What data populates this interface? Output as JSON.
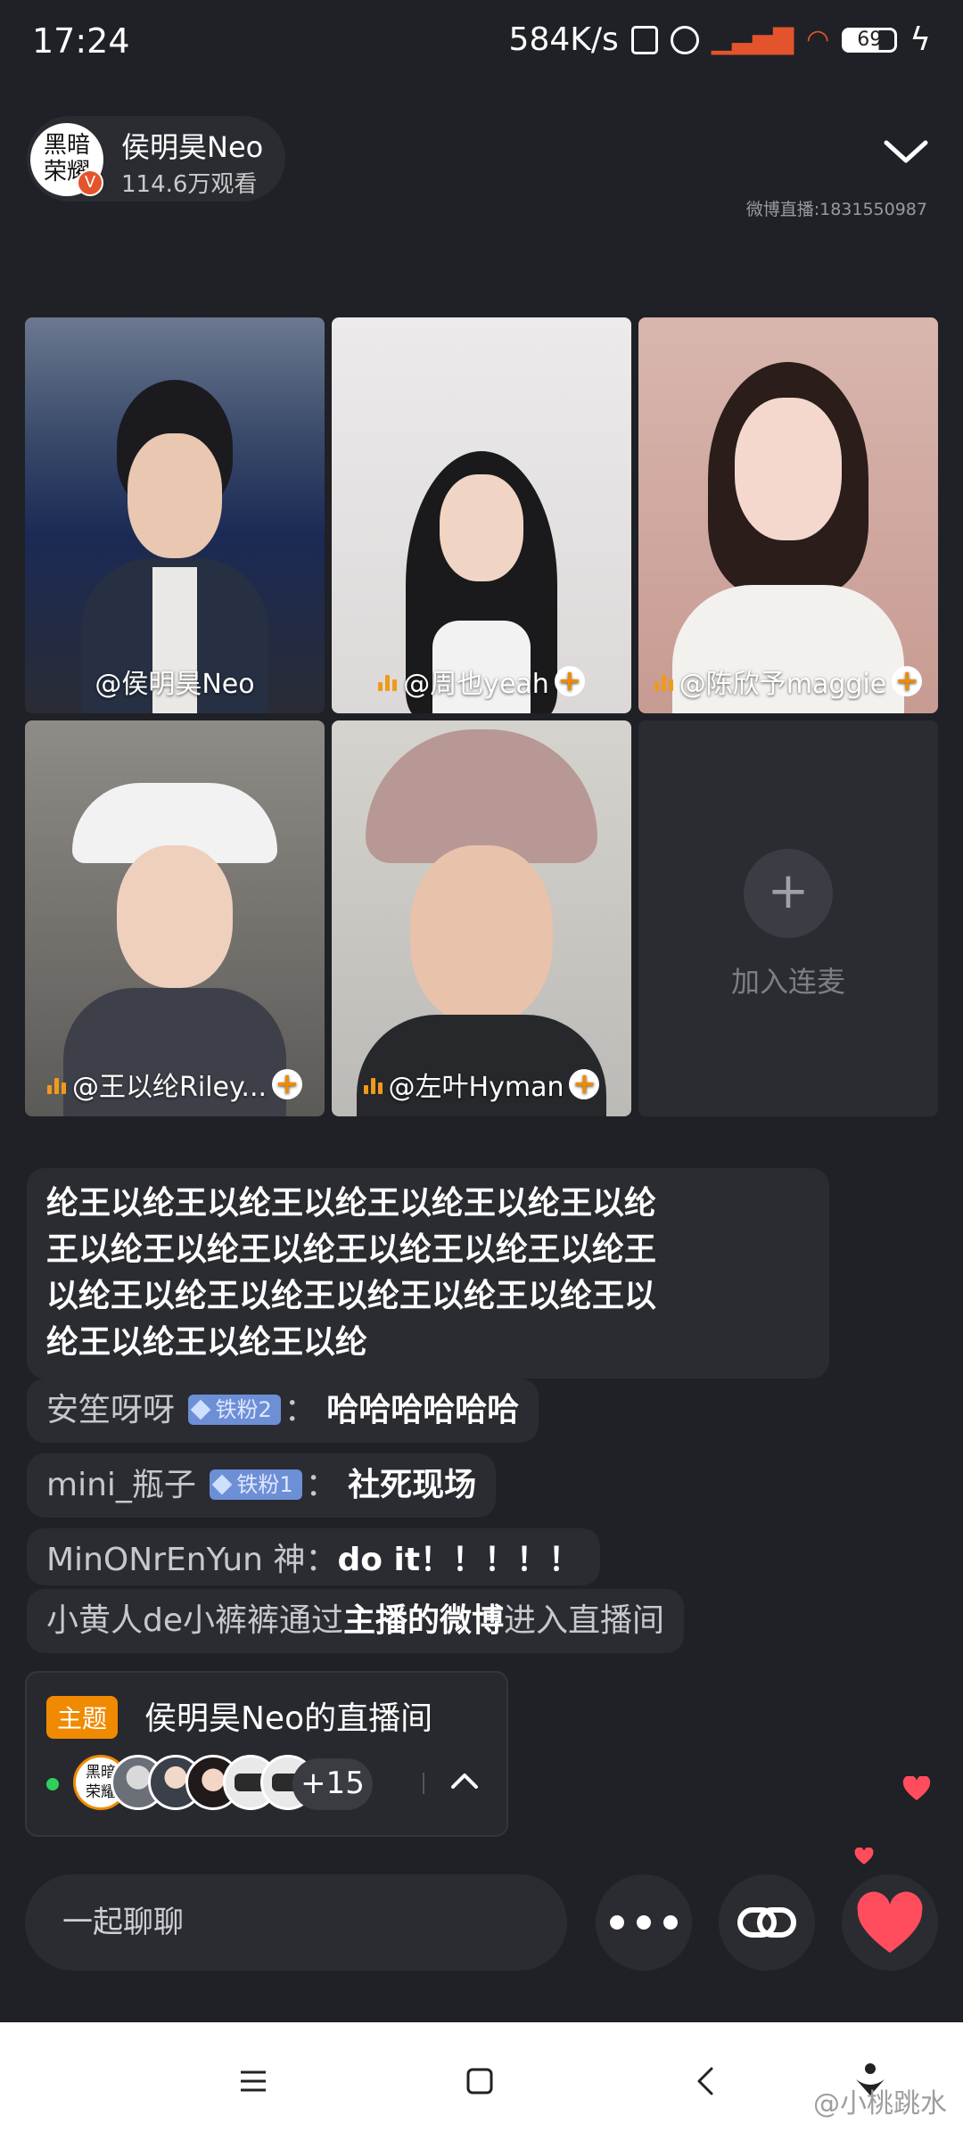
{
  "status": {
    "time": "17:24",
    "speed": "584K/s",
    "battery": "69"
  },
  "host": {
    "avatar_text": "黑暗荣耀",
    "name": "侯明昊Neo",
    "viewers": "114.6万观看",
    "room_id": "微博直播:1831550987"
  },
  "tiles": [
    {
      "label": "@侯明昊Neo"
    },
    {
      "label": "@周也yeah"
    },
    {
      "label": "@陈欣予maggie"
    },
    {
      "label": "@王以纶Riley..."
    },
    {
      "label": "@左叶Hyman"
    }
  ],
  "join": {
    "label": "加入连麦"
  },
  "chat": {
    "spam": "纶王以纶王以纶王以纶王以纶王以纶王以纶王以纶王以纶王以纶王以纶王以纶王以纶王以纶王以纶王以纶王以纶王以纶王以纶王以纶王以纶王以纶王以纶王以纶王以纶",
    "spam_lines": [
      "纶王以纶王以纶王以纶王以纶王以纶王以纶",
      "王以纶王以纶王以纶王以纶王以纶王以纶王",
      "以纶王以纶王以纶王以纶王以纶王以纶王以",
      "纶王以纶王以纶王以纶"
    ],
    "messages": [
      {
        "user": "安笙呀呀",
        "badge": "铁粉2",
        "sep": "：",
        "text": "哈哈哈哈哈哈"
      },
      {
        "user": "mini_瓶子",
        "badge": "铁粉1",
        "sep": "：",
        "text": "社死现场"
      },
      {
        "user": "MinONrEnYun 神",
        "sep": "：",
        "text": "do it！！！！！"
      }
    ],
    "entry": {
      "user": "小黄人de小裤裤通过",
      "source": "主播的微博",
      "action": "进入直播间"
    }
  },
  "topic": {
    "tag": "主题",
    "title": "侯明昊Neo的直播间",
    "more": "+15",
    "first_avatar_text": "黑暗荣耀"
  },
  "input": {
    "placeholder": "一起聊聊"
  },
  "watermark": "@小桃跳水",
  "colors": {
    "accent": "#f08a00",
    "bg": "#1f2126",
    "like": "#ff4d5e",
    "online": "#2fcf5a"
  }
}
